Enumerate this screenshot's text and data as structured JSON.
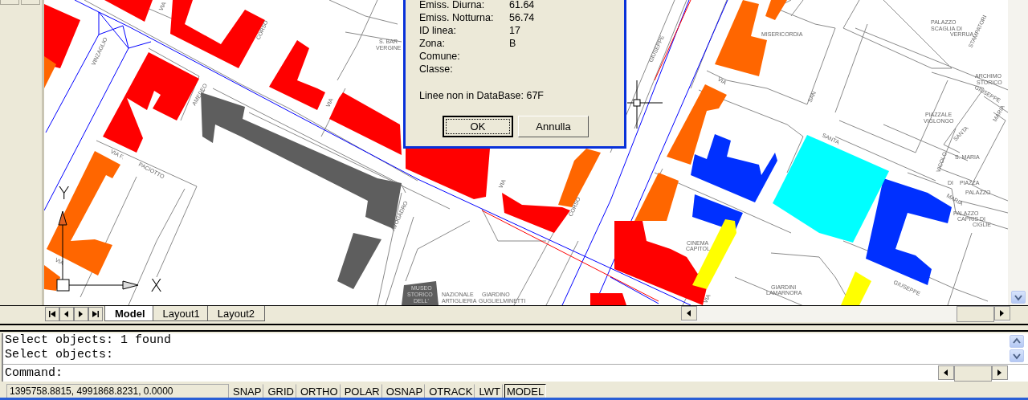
{
  "map_labels": [
    "VIA",
    "CORSO",
    "VINZAGLIO",
    "AMEDEO",
    "VIA F.",
    "PACIOTTO",
    "VIA",
    "AVOGADRO",
    "S. BAR",
    "VERGINE",
    "VIA",
    "VIA",
    "CORSO",
    "GIUSEPPE",
    "MISERICORDIA",
    "VIA",
    "SAN",
    "SANTA",
    "PALAZZO",
    "SCAGLIA DI",
    "VERRUA",
    "STAMPATORI",
    "ARCHIMO",
    "STORICO",
    "GIUSEPPE",
    "PIAZZALE",
    "VIGLONGO",
    "MARIA",
    "SANTA",
    "VICOLO",
    "S. MARIA",
    "DI",
    "PIAZZA",
    "PALAZZO",
    "MARIA",
    "PALAZZO",
    "CAPRIS DI",
    "CIGLIE",
    "CINEMA",
    "CAPITOL",
    "GIARDINI",
    "LAMARNORA",
    "GIUSEPPE",
    "VIA",
    "MUSEO",
    "STORICO",
    "NAZIONALE",
    "GIARDINO",
    "DELL'",
    "ARTIGLIERIA",
    "GUGLIELMINETTI"
  ],
  "ucs_icon": {
    "x_label": "X",
    "y_label": "Y"
  },
  "dialog": {
    "fields": [
      {
        "label": "Emiss. Diurna:",
        "value": "61.64"
      },
      {
        "label": "Emiss. Notturna:",
        "value": "56.74"
      },
      {
        "label": "ID linea:",
        "value": "17"
      },
      {
        "label": "Zona:",
        "value": "B"
      },
      {
        "label": "Comune:"
      },
      {
        "label": "Classe:"
      }
    ],
    "note": "Linee non in DataBase: 67F",
    "buttons": [
      {
        "label": "OK",
        "default": true
      },
      {
        "label": "Annulla",
        "default": false
      }
    ]
  },
  "layout_tabs": [
    {
      "label": "Model",
      "selected": true
    },
    {
      "label": "Layout1",
      "selected": false
    },
    {
      "label": "Layout2",
      "selected": false
    }
  ],
  "command": {
    "history": [
      "Select objects: 1 found",
      "Select objects:"
    ],
    "prompt": "Command:"
  },
  "status_bar": {
    "coordinates": "1395758.8815, 4991868.8231, 0.0000",
    "toggles": [
      {
        "label": "SNAP",
        "pressed": false
      },
      {
        "label": "GRID",
        "pressed": false
      },
      {
        "label": "ORTHO",
        "pressed": false
      },
      {
        "label": "POLAR",
        "pressed": false
      },
      {
        "label": "OSNAP",
        "pressed": false
      },
      {
        "label": "OTRACK",
        "pressed": false
      },
      {
        "label": "LWT",
        "pressed": false
      },
      {
        "label": "MODEL",
        "pressed": true
      }
    ]
  }
}
